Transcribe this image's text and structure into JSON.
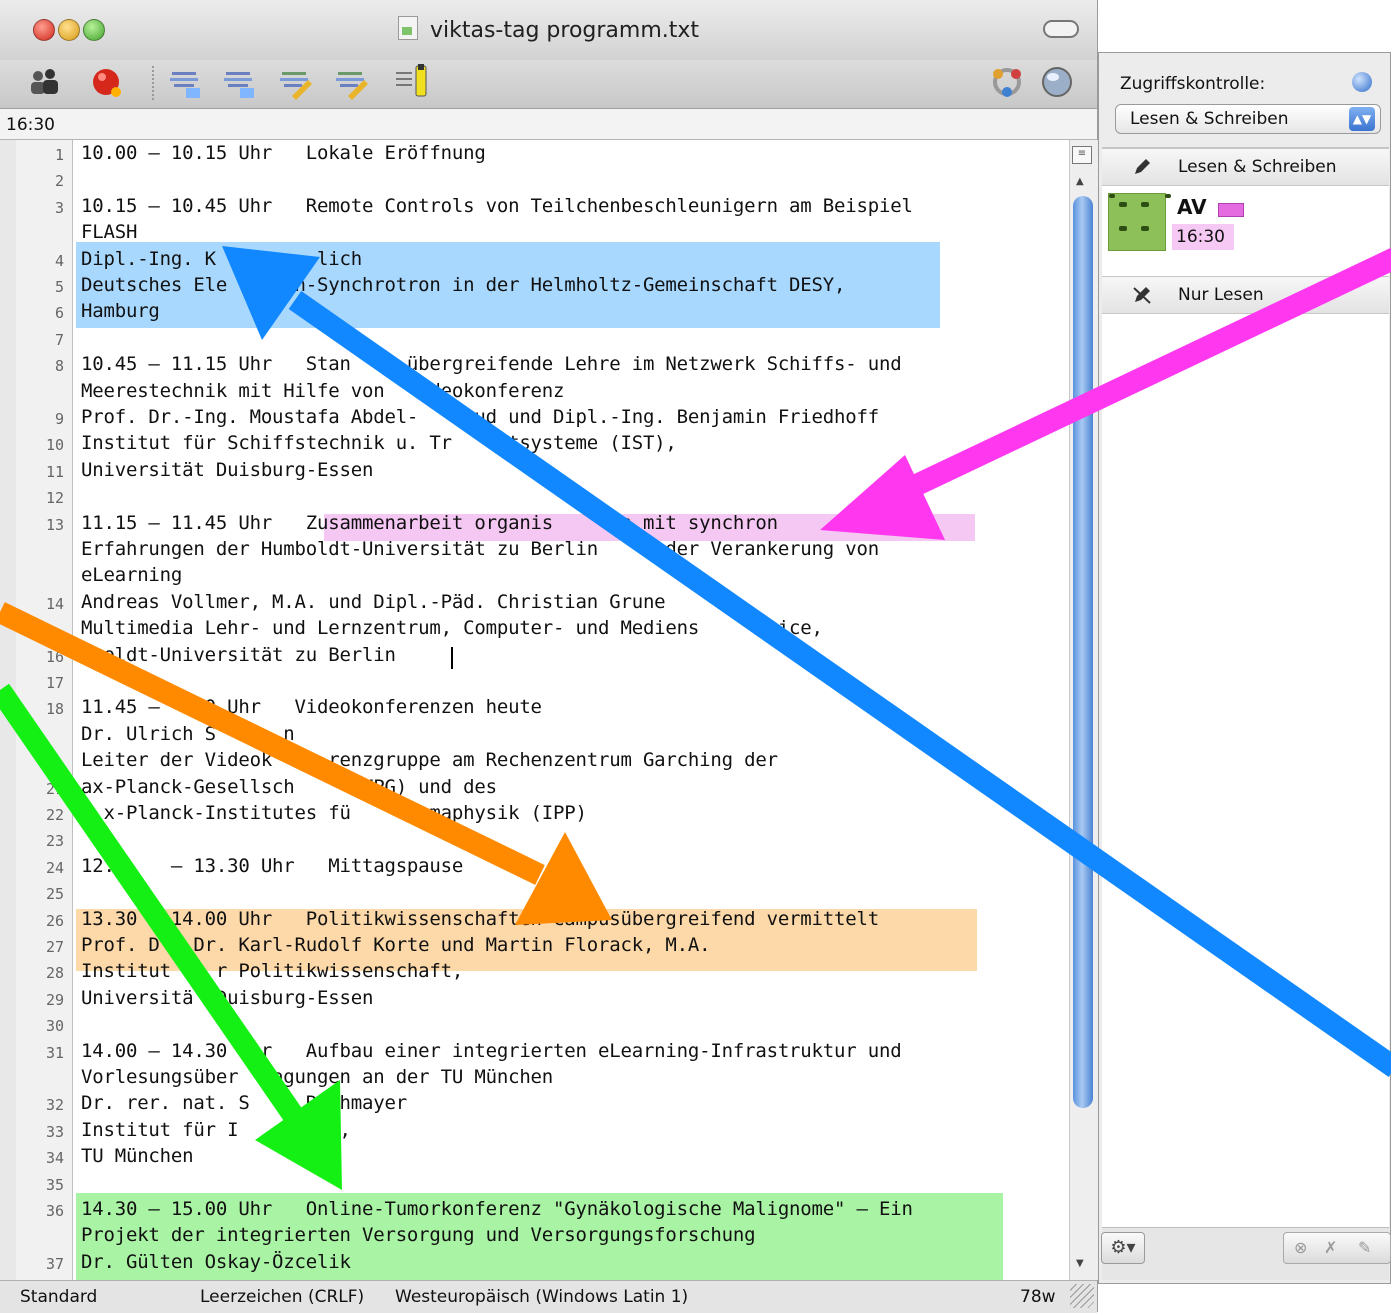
{
  "window": {
    "title": "viktas-tag programm.txt",
    "time_display": "16:30"
  },
  "toolbar": {
    "icons": [
      "participants-icon",
      "stop-icon",
      "doc-format-icon",
      "doc-format-2-icon",
      "doc-edit-icon",
      "doc-edit-2-icon",
      "highlighter-icon",
      "share-icon",
      "globe-icon"
    ]
  },
  "editor": {
    "lines": [
      {
        "num": "1",
        "text": "10.00 – 10.15 Uhr   Lokale Eröffnung"
      },
      {
        "num": "2",
        "text": ""
      },
      {
        "num": "3",
        "text": "10.15 – 10.45 Uhr   Remote Controls von Teilchenbeschleunigern am Beispiel"
      },
      {
        "num": "",
        "text": "FLASH"
      },
      {
        "num": "4",
        "text": "Dipl.-Ing. K         lich"
      },
      {
        "num": "5",
        "text": "Deutsches Ele      n-Synchrotron in der Helmholtz-Gemeinschaft DESY,"
      },
      {
        "num": "6",
        "text": "Hamburg"
      },
      {
        "num": "7",
        "text": ""
      },
      {
        "num": "8",
        "text": "10.45 – 11.15 Uhr   Stan     übergreifende Lehre im Netzwerk Schiffs- und"
      },
      {
        "num": "",
        "text": "Meerestechnik mit Hilfe von    deokonferenz"
      },
      {
        "num": "9",
        "text": "Prof. Dr.-Ing. Moustafa Abdel-    oud und Dipl.-Ing. Benjamin Friedhoff"
      },
      {
        "num": "10",
        "text": "Institut für Schiffstechnik u. Tr   ortsysteme (IST),"
      },
      {
        "num": "11",
        "text": "Universität Duisburg-Essen"
      },
      {
        "num": "12",
        "text": ""
      },
      {
        "num": "13",
        "text": "11.15 – 11.45 Uhr   Zusammenarbeit organis      n mit synchron       n –"
      },
      {
        "num": "",
        "text": "Erfahrungen der Humboldt-Universität zu Berlin    i der Verankerung von"
      },
      {
        "num": "",
        "text": "eLearning"
      },
      {
        "num": "14",
        "text": "Andreas Vollmer, M.A. und Dipl.-Päd. Christian Grune"
      },
      {
        "num": "",
        "text": "Multimedia Lehr- und Lernzentrum, Computer- und Mediens       ice,"
      },
      {
        "num": "16",
        "text": "  oldt-Universität zu Berlin"
      },
      {
        "num": "17",
        "text": ""
      },
      {
        "num": "18",
        "text": "11.45 –    0 Uhr   Videokonferenzen heute"
      },
      {
        "num": "",
        "text": "Dr. Ulrich S      n"
      },
      {
        "num": "",
        "text": "Leiter der Videok     renzgruppe am Rechenzentrum Garching der"
      },
      {
        "num": "21",
        "text": "ax-Planck-Gesellsch     (MPG) und des"
      },
      {
        "num": "22",
        "text": "  x-Planck-Institutes fü      smaphysik (IPP)"
      },
      {
        "num": "23",
        "text": ""
      },
      {
        "num": "24",
        "text": "12.     – 13.30 Uhr   Mittagspause"
      },
      {
        "num": "25",
        "text": ""
      },
      {
        "num": "26",
        "text": "13.30   14.00 Uhr   Politikwissenschaften Campusübergreifend vermittelt"
      },
      {
        "num": "27",
        "text": "Prof. D   Dr. Karl-Rudolf Korte und Martin Florack, M.A."
      },
      {
        "num": "28",
        "text": "Institut    r Politikwissenschaft,"
      },
      {
        "num": "29",
        "text": "Universitä  Duisburg-Essen"
      },
      {
        "num": "30",
        "text": ""
      },
      {
        "num": "31",
        "text": "14.00 – 14.30  hr   Aufbau einer integrierten eLearning-Infrastruktur und"
      },
      {
        "num": "",
        "text": "Vorlesungsüber   agungen an der TU München"
      },
      {
        "num": "32",
        "text": "Dr. rer. nat. S     Rathmayer"
      },
      {
        "num": "33",
        "text": "Institut für I       ik,"
      },
      {
        "num": "34",
        "text": "TU München"
      },
      {
        "num": "35",
        "text": ""
      },
      {
        "num": "36",
        "text": "14.30 – 15.00 Uhr   Online-Tumorkonferenz \"Gynäkologische Malignome\" – Ein"
      },
      {
        "num": "",
        "text": "Projekt der integrierten Versorgung und Versorgungsforschung"
      },
      {
        "num": "37",
        "text": "Dr. Gülten Oskay-Özcelik"
      }
    ],
    "highlight_colors": {
      "blue": "#a9d8ff",
      "pink": "#f5c7f3",
      "orange": "#fdd9a9",
      "green": "#a9f3a4"
    }
  },
  "statusbar": {
    "mode": "Standard",
    "line_ending": "Leerzeichen (CRLF)",
    "encoding": "Westeuropäisch (Windows Latin 1)",
    "word_count": "78w"
  },
  "drawer": {
    "access_label": "Zugriffskontrolle:",
    "access_value": "Lesen & Schreiben",
    "group_rw": "Lesen & Schreiben",
    "group_ro": "Nur Lesen",
    "participant_name": "AV",
    "participant_time": "16:30"
  },
  "annotation_arrows": {
    "colors": {
      "magenta": "#ff38f0",
      "blue": "#1188ff",
      "orange": "#ff8a00",
      "green": "#14f014"
    }
  }
}
